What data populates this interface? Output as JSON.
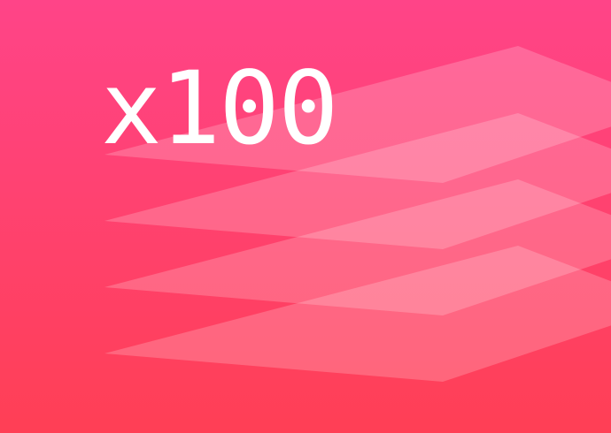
{
  "hero": {
    "multiplier_text": "x100",
    "layer_count": 4
  },
  "colors": {
    "gradient_top": "#ff4488",
    "gradient_bottom": "#ff3f55",
    "layer_fill": "#ffffff",
    "text": "#ffffff"
  },
  "icon": "stacked-layers-icon"
}
